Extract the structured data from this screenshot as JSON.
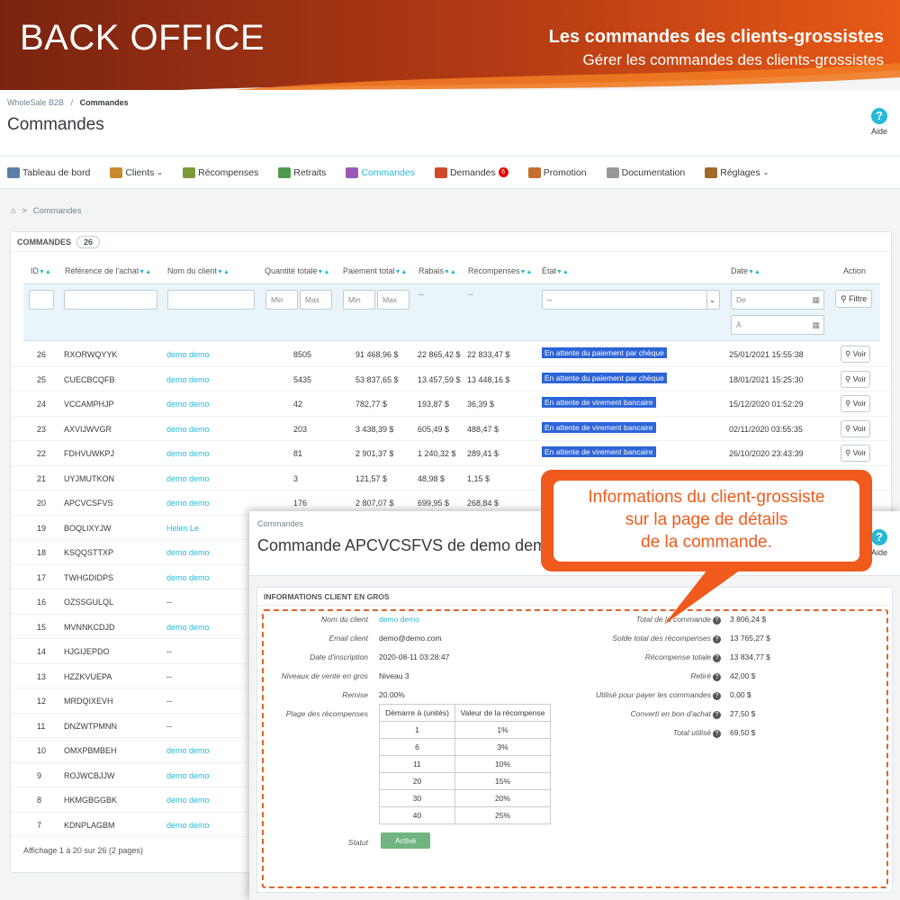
{
  "banner": {
    "left": "BACK OFFICE",
    "right_title": "Les commandes des clients-grossistes",
    "right_sub": "Gérer les commandes des clients-grossistes"
  },
  "header": {
    "breadcrumb_root": "WholeSale B2B",
    "breadcrumb_sep": "/",
    "breadcrumb_current": "Commandes",
    "title": "Commandes",
    "help_label": "Aide"
  },
  "nav": [
    {
      "label": "Tableau de bord",
      "icon": "dashboard-icon",
      "color": "#5a7fa8"
    },
    {
      "label": "Clients",
      "icon": "users-icon",
      "color": "#c98a2e",
      "chevron": "⌄"
    },
    {
      "label": "Récompenses",
      "icon": "reward-icon",
      "color": "#7a9a3a"
    },
    {
      "label": "Retraits",
      "icon": "withdraw-icon",
      "color": "#4e9a4e"
    },
    {
      "label": "Commandes",
      "icon": "cart-icon",
      "color": "#9b59b6",
      "active": true
    },
    {
      "label": "Demandes",
      "icon": "check-icon",
      "color": "#d04a2a",
      "badge": "6"
    },
    {
      "label": "Promotion",
      "icon": "box-icon",
      "color": "#c4702e"
    },
    {
      "label": "Documentation",
      "icon": "doc-icon",
      "color": "#999999"
    },
    {
      "label": "Réglages",
      "icon": "gears-icon",
      "color": "#a06a2a",
      "chevron": "⌄"
    }
  ],
  "breadcrumb2": {
    "home": "⌂",
    "sep": ">",
    "label": "Commandes"
  },
  "panel": {
    "title": "COMMANDES",
    "count": "26",
    "columns": [
      "ID",
      "Référence de l'achat",
      "Nom du client",
      "Quantité totale",
      "Paiement total",
      "Rabais",
      "Récompenses",
      "État",
      "Date",
      "Action"
    ],
    "filters": {
      "min": "Min",
      "max": "Max",
      "dash": "--",
      "select": "--",
      "date_from": "De",
      "date_to": "À",
      "filter_btn": "Filtre"
    },
    "rows": [
      {
        "id": "26",
        "ref": "RXORWQYYK",
        "client": "demo demo",
        "qty": "8505",
        "total": "91 468,96 $",
        "rabais": "22 865,42 $",
        "recomp": "22 833,47 $",
        "state": "En attente du paiement par chèque",
        "date": "25/01/2021 15:55:38",
        "voir": "Voir"
      },
      {
        "id": "25",
        "ref": "CUECBCQFB",
        "client": "demo demo",
        "qty": "5435",
        "total": "53 837,65 $",
        "rabais": "13 457,59 $",
        "recomp": "13 448,16 $",
        "state": "En attente du paiement par chèque",
        "date": "18/01/2021 15:25:30",
        "voir": "Voir"
      },
      {
        "id": "24",
        "ref": "VCCAMPHJP",
        "client": "demo demo",
        "qty": "42",
        "total": "782,77 $",
        "rabais": "193,87 $",
        "recomp": "36,39 $",
        "state": "En attente de virement bancaire",
        "date": "15/12/2020 01:52:29",
        "voir": "Voir"
      },
      {
        "id": "23",
        "ref": "AXVIJWVGR",
        "client": "demo demo",
        "qty": "203",
        "total": "3 438,39 $",
        "rabais": "605,49 $",
        "recomp": "488,47 $",
        "state": "En attente de virement bancaire",
        "date": "02/11/2020 03:55:35",
        "voir": "Voir"
      },
      {
        "id": "22",
        "ref": "FDHVUWKPJ",
        "client": "demo demo",
        "qty": "81",
        "total": "2 901,37 $",
        "rabais": "1 240,32 $",
        "recomp": "289,41 $",
        "state": "En attente de virement bancaire",
        "date": "26/10/2020 23:43:39",
        "voir": "Voir"
      },
      {
        "id": "21",
        "ref": "UYJMUTKON",
        "client": "demo demo",
        "qty": "3",
        "total": "121,57 $",
        "rabais": "48,98 $",
        "recomp": "1,15 $",
        "state": "",
        "date": "",
        "voir": ""
      },
      {
        "id": "20",
        "ref": "APCVCSFVS",
        "client": "demo demo",
        "qty": "176",
        "total": "2 807,07 $",
        "rabais": "699,95 $",
        "recomp": "268,84 $",
        "state": "",
        "date": "",
        "voir": ""
      },
      {
        "id": "19",
        "ref": "BOQLIXYJW",
        "client": "Helen Le"
      },
      {
        "id": "18",
        "ref": "KSQQSTTXP",
        "client": "demo demo"
      },
      {
        "id": "17",
        "ref": "TWHGDIDPS",
        "client": "demo demo"
      },
      {
        "id": "16",
        "ref": "OZSSGULQL",
        "client": "--"
      },
      {
        "id": "15",
        "ref": "MVNNKCDJD",
        "client": "demo demo"
      },
      {
        "id": "14",
        "ref": "HJGIJEPDO",
        "client": "--"
      },
      {
        "id": "13",
        "ref": "HZZKVUEPA",
        "client": "--"
      },
      {
        "id": "12",
        "ref": "MRDQIXEVH",
        "client": "--"
      },
      {
        "id": "11",
        "ref": "DNZWTPMNN",
        "client": "--"
      },
      {
        "id": "10",
        "ref": "OMXPBMBEH",
        "client": "demo demo"
      },
      {
        "id": "9",
        "ref": "ROJWCBJJW",
        "client": "demo demo"
      },
      {
        "id": "8",
        "ref": "HKMGBGGBK",
        "client": "demo demo"
      },
      {
        "id": "7",
        "ref": "KDNPLAGBM",
        "client": "demo demo"
      }
    ],
    "footer": "Affichage 1 à 20 sur 26 (2 pages)"
  },
  "overlay": {
    "breadcrumb": "Commandes",
    "title": "Commande APCVCSFVS de demo dem",
    "help_label": "Aide",
    "card_title": "INFORMATIONS CLIENT EN GROS",
    "left": [
      {
        "label": "Nom du client",
        "value": "demo demo",
        "link": true
      },
      {
        "label": "Email client",
        "value": "demo@demo.com"
      },
      {
        "label": "Date d'inscription",
        "value": "2020-08-11 03:28:47"
      },
      {
        "label": "Niveaux de vente en gros",
        "value": "Niveau 3"
      },
      {
        "label": "Remise",
        "value": "20.00%"
      },
      {
        "label": "Plage des récompenses",
        "value": ""
      }
    ],
    "reward_table": {
      "headers": [
        "Démarre à (unités)",
        "Valeur de la récompense"
      ],
      "rows": [
        [
          "1",
          "1%"
        ],
        [
          "6",
          "3%"
        ],
        [
          "11",
          "10%"
        ],
        [
          "20",
          "15%"
        ],
        [
          "30",
          "20%"
        ],
        [
          "40",
          "25%"
        ]
      ]
    },
    "status_label": "Statut",
    "status_value": "Activé",
    "right": [
      {
        "label": "Total de la commande",
        "value": "3 806,24 $"
      },
      {
        "label": "Solde total des récompenses",
        "value": "13 765,27 $"
      },
      {
        "label": "Récompense totale",
        "value": "13 834,77 $"
      },
      {
        "label": "Retiré",
        "value": "42,00 $"
      },
      {
        "label": "Utilisé pour payer les commandes",
        "value": "0,00 $"
      },
      {
        "label": "Converti en bon d'achat",
        "value": "27,50 $"
      },
      {
        "label": "Total utilisé",
        "value": "69,50 $"
      }
    ]
  },
  "callout": {
    "line1": "Informations du client-grossiste",
    "line2": "sur la page de détails",
    "line3": "de la commande."
  },
  "colors": {
    "accent": "#25b9d7",
    "orange": "#f05a1c",
    "banner_dark": "#8a2a12",
    "state_blue": "#2d64d8",
    "status_green": "#70b580"
  }
}
